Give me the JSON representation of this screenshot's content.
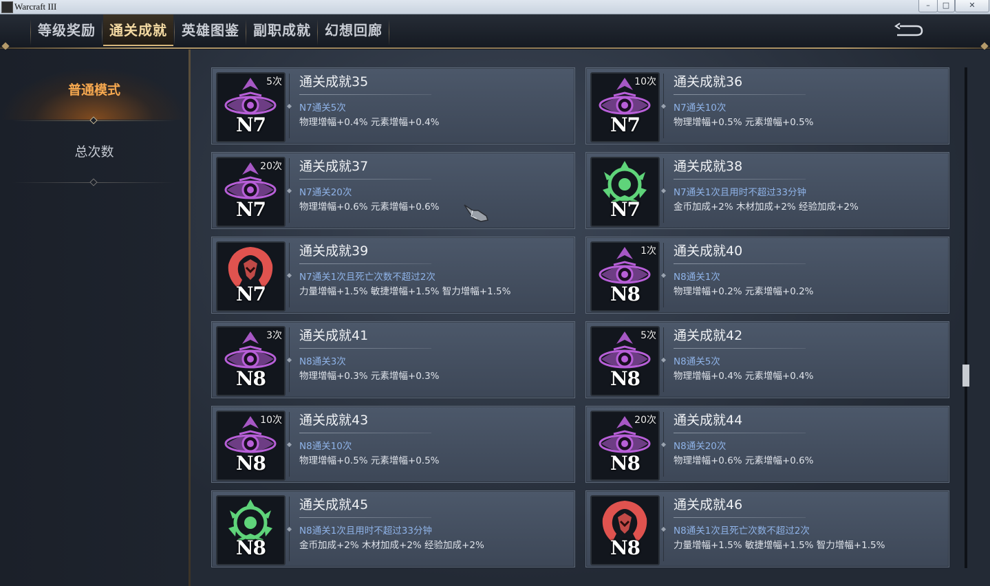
{
  "window": {
    "title": "Warcraft III",
    "min": "–",
    "max": "□",
    "close": "✕"
  },
  "tabs": [
    {
      "label": "等级奖励",
      "active": false
    },
    {
      "label": "通关成就",
      "active": true
    },
    {
      "label": "英雄图鉴",
      "active": false
    },
    {
      "label": "副职成就",
      "active": false
    },
    {
      "label": "幻想回廊",
      "active": false
    }
  ],
  "sidebar": {
    "items": [
      {
        "label": "普通模式",
        "active": true
      },
      {
        "label": "总次数",
        "active": false
      }
    ]
  },
  "colors": {
    "purple": "#b85fd8",
    "green": "#5fd47a",
    "red": "#e0534f",
    "accent": "#f6a84f"
  },
  "cards": [
    {
      "title": "通关成就35",
      "cond": "N7通关5次",
      "bonus": "物理增幅+0.4% 元素增幅+0.4%",
      "badge": "N7",
      "count": "5次",
      "emblem": "purple"
    },
    {
      "title": "通关成就36",
      "cond": "N7通关10次",
      "bonus": "物理增幅+0.5% 元素增幅+0.5%",
      "badge": "N7",
      "count": "10次",
      "emblem": "purple"
    },
    {
      "title": "通关成就37",
      "cond": "N7通关20次",
      "bonus": "物理增幅+0.6% 元素增幅+0.6%",
      "badge": "N7",
      "count": "20次",
      "emblem": "purple"
    },
    {
      "title": "通关成就38",
      "cond": "N7通关1次且用时不超过33分钟",
      "bonus": "金币加成+2% 木材加成+2% 经验加成+2%",
      "badge": "N7",
      "count": "",
      "emblem": "green"
    },
    {
      "title": "通关成就39",
      "cond": "N7通关1次且死亡次数不超过2次",
      "bonus": "力量增幅+1.5% 敏捷增幅+1.5% 智力增幅+1.5%",
      "badge": "N7",
      "count": "",
      "emblem": "red"
    },
    {
      "title": "通关成就40",
      "cond": "N8通关1次",
      "bonus": "物理增幅+0.2% 元素增幅+0.2%",
      "badge": "N8",
      "count": "1次",
      "emblem": "purple"
    },
    {
      "title": "通关成就41",
      "cond": "N8通关3次",
      "bonus": "物理增幅+0.3% 元素增幅+0.3%",
      "badge": "N8",
      "count": "3次",
      "emblem": "purple"
    },
    {
      "title": "通关成就42",
      "cond": "N8通关5次",
      "bonus": "物理增幅+0.4% 元素增幅+0.4%",
      "badge": "N8",
      "count": "5次",
      "emblem": "purple"
    },
    {
      "title": "通关成就43",
      "cond": "N8通关10次",
      "bonus": "物理增幅+0.5% 元素增幅+0.5%",
      "badge": "N8",
      "count": "10次",
      "emblem": "purple"
    },
    {
      "title": "通关成就44",
      "cond": "N8通关20次",
      "bonus": "物理增幅+0.6% 元素增幅+0.6%",
      "badge": "N8",
      "count": "20次",
      "emblem": "purple"
    },
    {
      "title": "通关成就45",
      "cond": "N8通关1次且用时不超过33分钟",
      "bonus": "金币加成+2% 木材加成+2% 经验加成+2%",
      "badge": "N8",
      "count": "",
      "emblem": "green"
    },
    {
      "title": "通关成就46",
      "cond": "N8通关1次且死亡次数不超过2次",
      "bonus": "力量增幅+1.5% 敏捷增幅+1.5% 智力增幅+1.5%",
      "badge": "N8",
      "count": "",
      "emblem": "red"
    }
  ]
}
